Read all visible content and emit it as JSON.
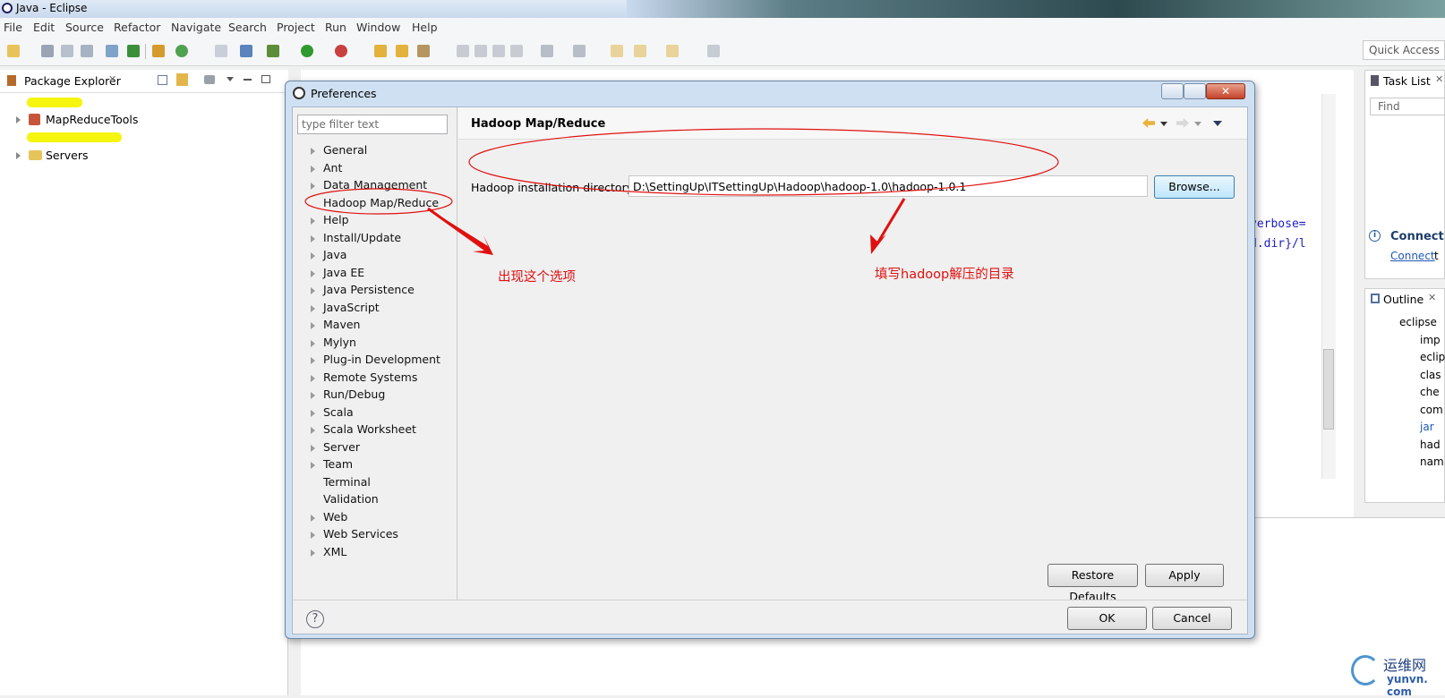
{
  "window": {
    "title": "Java - Eclipse"
  },
  "menu": [
    "File",
    "Edit",
    "Source",
    "Refactor",
    "Navigate",
    "Search",
    "Project",
    "Run",
    "Window",
    "Help"
  ],
  "quick_access": {
    "placeholder": "Quick Access"
  },
  "package_explorer": {
    "title": "Package Explorer",
    "items": [
      "MapReduceTools",
      "Servers"
    ]
  },
  "editor": {
    "code_lines": [
      "verbose=",
      "d.dir}/l"
    ]
  },
  "task_list": {
    "title": "Task List",
    "find_placeholder": "Find",
    "connect_title": "Connect",
    "connect_link": "Connect",
    "connect_after": "t"
  },
  "outline": {
    "title": "Outline",
    "items": [
      "eclipse",
      "imp",
      "eclip",
      "clas",
      "che",
      "com",
      "jar",
      "had",
      "nam"
    ]
  },
  "dialog": {
    "title": "Preferences",
    "filter_placeholder": "type filter text",
    "tree": [
      "General",
      "Ant",
      "Data Management",
      "Hadoop Map/Reduce",
      "Help",
      "Install/Update",
      "Java",
      "Java EE",
      "Java Persistence",
      "JavaScript",
      "Maven",
      "Mylyn",
      "Plug-in Development",
      "Remote Systems",
      "Run/Debug",
      "Scala",
      "Scala Worksheet",
      "Server",
      "Team",
      "Terminal",
      "Validation",
      "Web",
      "Web Services",
      "XML"
    ],
    "page_title": "Hadoop Map/Reduce",
    "dir_label": "Hadoop installation directory:",
    "dir_value": "D:\\SettingUp\\ITSettingUp\\Hadoop\\hadoop-1.0\\hadoop-1.0.1",
    "browse": "Browse...",
    "restore_defaults": "Restore Defaults",
    "apply": "Apply",
    "ok": "OK",
    "cancel": "Cancel",
    "help_glyph": "?",
    "close_glyph": "✕"
  },
  "annotations": {
    "option_note": "出现这个选项",
    "dir_note": "填写hadoop解压的目录",
    "color": "#e01010"
  },
  "watermark": {
    "cn": "运维网",
    "en": "yunvn. com"
  }
}
